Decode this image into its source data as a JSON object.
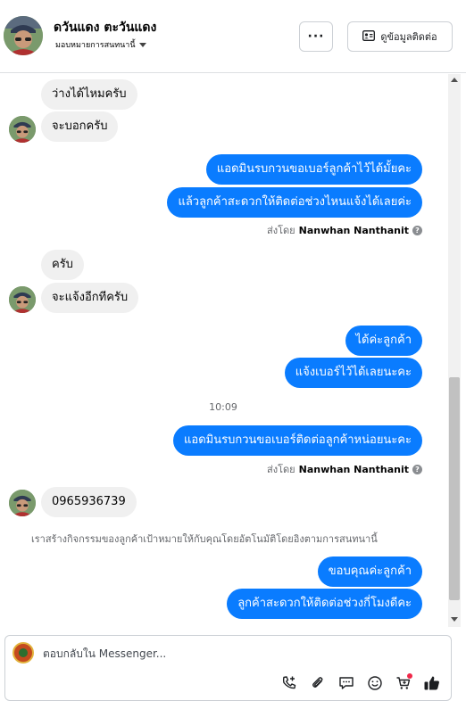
{
  "header": {
    "contact_name": "ดวันแดง ตะวันแดง",
    "assign_label": "มอบหมายการสนทนานี้",
    "more_label": "···",
    "contact_info_label": "ดูข้อมูลติดต่อ"
  },
  "messages": {
    "in_1": "ว่างได้ไหมครับ",
    "in_2": "จะบอกครับ",
    "out_1": "แอดมินรบกวนขอเบอร์ลูกค้าไว้ได้มั้ยคะ",
    "out_2": "แล้วลูกค้าสะดวกให้ติดต่อช่วงไหนแจ้งได้เลยค่ะ",
    "sent_by_1_prefix": "ส่งโดย",
    "sent_by_1_name": "Nanwhan Nanthanit",
    "in_3": "ครับ",
    "in_4": "จะแจ้งอีกทีครับ",
    "out_3": "ได้ค่ะลูกค้า",
    "out_4": "แจ้งเบอร์ไว้ได้เลยนะคะ",
    "timestamp": "10:09",
    "out_5": "แอดมินรบกวนขอเบอร์ติดต่อลูกค้าหน่อยนะคะ",
    "sent_by_2_prefix": "ส่งโดย",
    "sent_by_2_name": "Nanwhan Nanthanit",
    "in_5": "0965936739",
    "system_note": "เราสร้างกิจกรรมของลูกค้าเป้าหมายให้กับคุณโดยอัตโนมัติโดยอิงตามการสนทนานี้",
    "out_6": "ขอบคุณค่ะลูกค้า",
    "out_7": "ลูกค้าสะดวกให้ติดต่อช่วงกี่โมงดีคะ"
  },
  "composer": {
    "placeholder": "ตอบกลับใน Messenger..."
  },
  "icons": {
    "help": "question-mark-icon",
    "call": "phone-add-icon",
    "attach": "paperclip-icon",
    "saved_replies": "chat-bubble-icon",
    "emoji": "smiley-icon",
    "order": "cart-add-icon",
    "like": "thumbs-up-icon"
  },
  "colors": {
    "outgoing_bubble": "#0a7cff",
    "incoming_bubble": "#f0f0f0",
    "like_icon": "#1c1e21",
    "notification_dot": "#f02849"
  }
}
